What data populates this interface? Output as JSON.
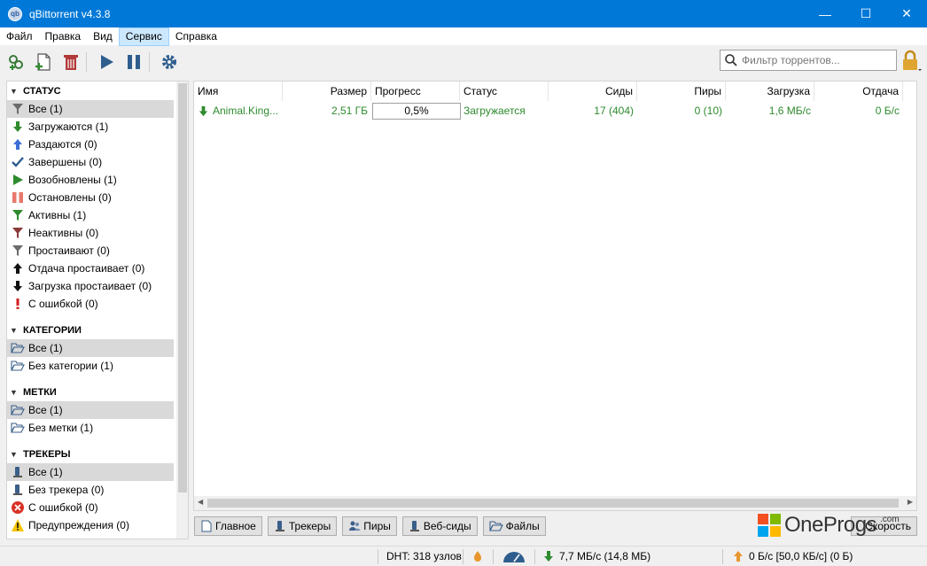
{
  "window": {
    "title": "qBittorrent v4.3.8",
    "app_icon": "qb",
    "minimize": "—",
    "maximize": "☐",
    "close": "✕"
  },
  "menu": [
    "Файл",
    "Правка",
    "Вид",
    "Сервис",
    "Справка"
  ],
  "search": {
    "placeholder": "Фильтр торрентов..."
  },
  "sidebar": {
    "status": {
      "title": "СТАТУС",
      "items": [
        {
          "label": "Все (1)",
          "icon": "filter-icon"
        },
        {
          "label": "Загружаются (1)",
          "icon": "arrow-down-icon"
        },
        {
          "label": "Раздаются (0)",
          "icon": "arrow-up-icon"
        },
        {
          "label": "Завершены (0)",
          "icon": "checkmark-icon"
        },
        {
          "label": "Возобновлены (1)",
          "icon": "play-icon"
        },
        {
          "label": "Остановлены (0)",
          "icon": "pause-icon"
        },
        {
          "label": "Активны (1)",
          "icon": "filter-green-icon"
        },
        {
          "label": "Неактивны (0)",
          "icon": "filter-red-icon"
        },
        {
          "label": "Простаивают (0)",
          "icon": "filter-gray-icon"
        },
        {
          "label": "Отдача простаивает (0)",
          "icon": "arrow-up-black-icon"
        },
        {
          "label": "Загрузка простаивает (0)",
          "icon": "arrow-down-black-icon"
        },
        {
          "label": "С ошибкой (0)",
          "icon": "exclamation-icon"
        }
      ]
    },
    "categories": {
      "title": "КАТЕГОРИИ",
      "items": [
        {
          "label": "Все (1)"
        },
        {
          "label": "Без категории (1)"
        }
      ]
    },
    "tags": {
      "title": "МЕТКИ",
      "items": [
        {
          "label": "Все (1)"
        },
        {
          "label": "Без метки (1)"
        }
      ]
    },
    "trackers": {
      "title": "ТРЕКЕРЫ",
      "items": [
        {
          "label": "Все (1)",
          "icon": "tracker-icon"
        },
        {
          "label": "Без трекера (0)",
          "icon": "tracker-icon"
        },
        {
          "label": "С ошибкой (0)",
          "icon": "error-circle-icon"
        },
        {
          "label": "Предупреждения (0)",
          "icon": "warning-icon"
        }
      ]
    }
  },
  "table": {
    "columns": [
      "Имя",
      "Размер",
      "Прогресс",
      "Статус",
      "Сиды",
      "Пиры",
      "Загрузка",
      "Отдача"
    ],
    "rows": [
      {
        "name": "Animal.King...",
        "size": "2,51 ГБ",
        "progress_text": "0,5%",
        "progress": 0.005,
        "status": "Загружается",
        "seeds": "17 (404)",
        "peers": "0 (10)",
        "down": "1,6 МБ/с",
        "up": "0 Б/с"
      }
    ]
  },
  "tabs": [
    "Главное",
    "Трекеры",
    "Пиры",
    "Веб-сиды",
    "Файлы"
  ],
  "speed_button": "Скорость",
  "watermark": {
    "brand": "OneProgs",
    "suffix": ".com"
  },
  "statusbar": {
    "dht": "DHT: 318 узлов",
    "download": "7,7 МБ/с (14,8 МБ)",
    "upload": "0 Б/с [50,0 КБ/с] (0 Б)"
  },
  "colors": {
    "titlebar": "#0078d7",
    "download_green": "#2e8b2e",
    "selection": "#d9d9d9"
  }
}
